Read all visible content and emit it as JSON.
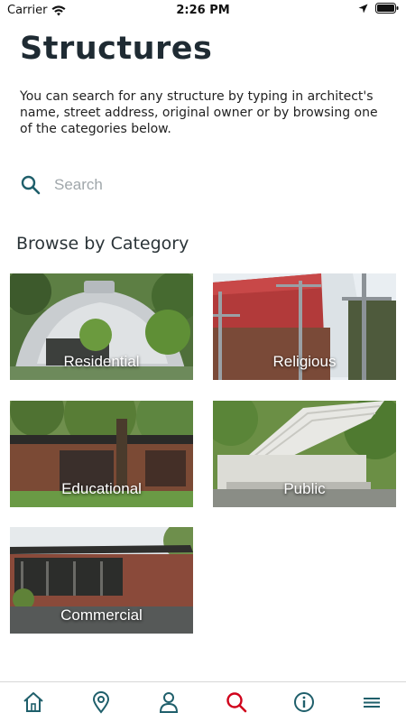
{
  "status": {
    "carrier": "Carrier",
    "time": "2:26 PM"
  },
  "header": {
    "title": "Structures"
  },
  "intro": "You can search for any structure by typing in architect's name, street address, original owner or by browsing one of the categories below.",
  "search": {
    "placeholder": "Search",
    "value": ""
  },
  "browse": {
    "title": "Browse by Category",
    "categories": [
      {
        "label": "Residential"
      },
      {
        "label": "Religious"
      },
      {
        "label": "Educational"
      },
      {
        "label": "Public"
      },
      {
        "label": "Commercial"
      }
    ]
  },
  "tabs": [
    {
      "icon": "home-icon"
    },
    {
      "icon": "map-pin-icon"
    },
    {
      "icon": "person-icon"
    },
    {
      "icon": "search-icon",
      "active": true
    },
    {
      "icon": "info-icon"
    },
    {
      "icon": "menu-icon"
    }
  ],
  "colors": {
    "primary": "#1f5f6b",
    "active_tab": "#d0021b",
    "text": "#1f2b33"
  }
}
